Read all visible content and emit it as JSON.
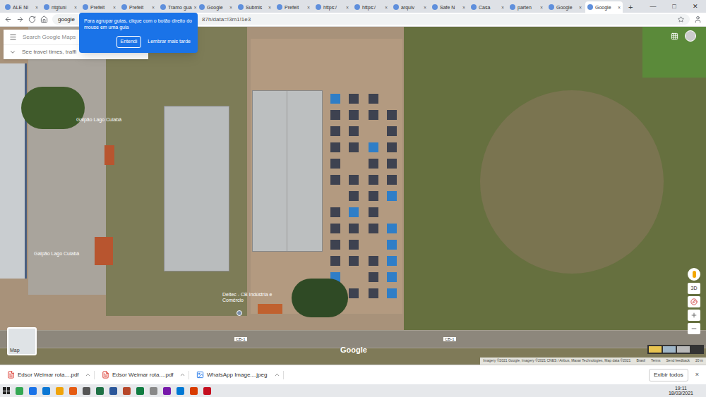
{
  "browser": {
    "tabs": [
      {
        "label": "ALE NI",
        "selected": false
      },
      {
        "label": "ntgtuni",
        "selected": false
      },
      {
        "label": "Prefeit",
        "selected": false
      },
      {
        "label": "Prefeit",
        "selected": false
      },
      {
        "label": "Tramo gua",
        "selected": false
      },
      {
        "label": "Google",
        "selected": false
      },
      {
        "label": "Submis",
        "selected": false
      },
      {
        "label": "Prefeit",
        "selected": false
      },
      {
        "label": "https:/",
        "selected": false
      },
      {
        "label": "https:/",
        "selected": false
      },
      {
        "label": "arquiv",
        "selected": false
      },
      {
        "label": "Safe N",
        "selected": false
      },
      {
        "label": "Casa",
        "selected": false
      },
      {
        "label": "parten",
        "selected": false
      },
      {
        "label": "Google",
        "selected": false
      },
      {
        "label": "Google",
        "selected": true
      }
    ],
    "tab_close": "×",
    "new_tab": "+",
    "window_controls": [
      "—",
      "□",
      "✕"
    ],
    "address": "google",
    "address_tail": "87h/data=!3m1!1e3"
  },
  "tooltip": {
    "text": "Para agrupar guias, clique com o botão direito do mouse em uma guia",
    "buttons": [
      "Entendi",
      "Lembrar mais tarde"
    ]
  },
  "map": {
    "search_placeholder": "Search Google Maps",
    "travel_hint": "See travel times, traffi",
    "labels": [
      {
        "text": "Galpão Lago Cuiabá"
      },
      {
        "text": "Galpão Lago Cuiabá"
      },
      {
        "text": "Deltec - CB Indústria e Comércio"
      }
    ],
    "road_labels": [
      "CB-1",
      "CB-1"
    ],
    "layer_label": "Map",
    "control_3d": "3D",
    "watermark": "Google",
    "attribution": [
      "Imagery ©2021 Google, Imagery ©2021 CNES / Airbus, Maxar Technologies, Map data ©2021",
      "Brasil",
      "Terms",
      "Send feedback",
      "20 m"
    ]
  },
  "downloads": {
    "items": [
      "Edsor Weimar rota....pdf",
      "Edsor Weimar rota....pdf",
      "WhatsApp Image....jpeg"
    ],
    "show_all": "Exibir todos",
    "close": "×"
  },
  "taskbar": {
    "time": "19:11",
    "date": "18/03/2021"
  }
}
